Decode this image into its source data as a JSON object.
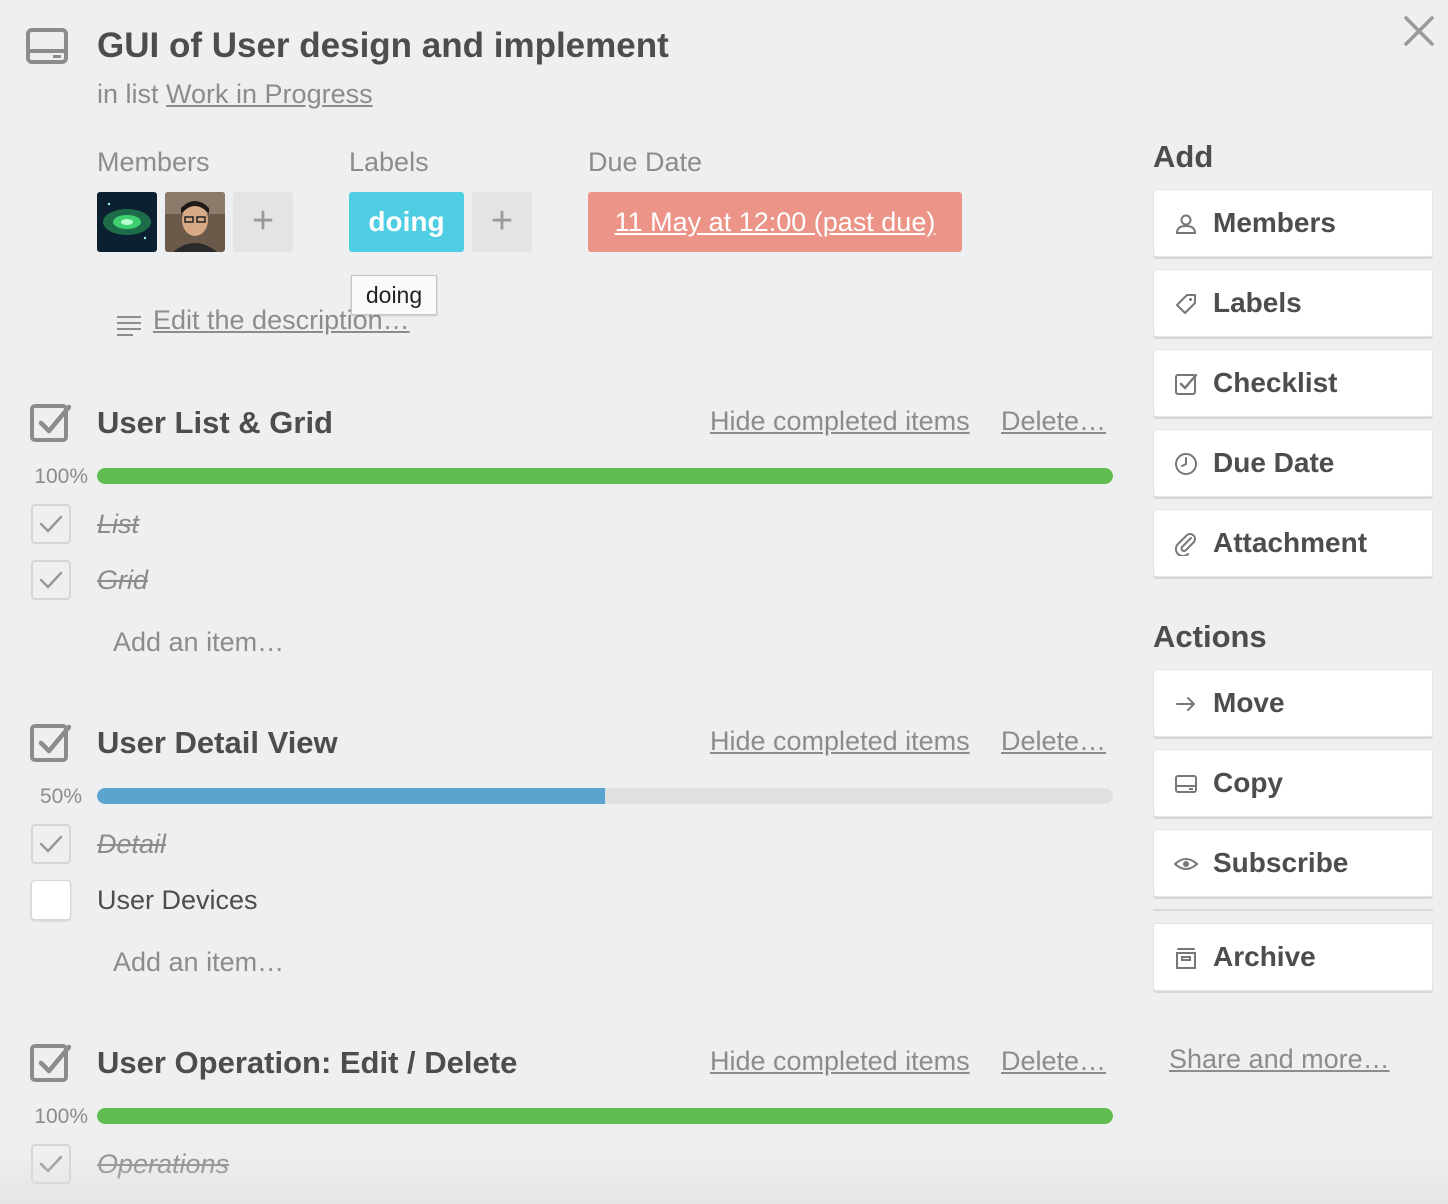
{
  "card": {
    "title": "GUI of User design and implement",
    "list_prefix": "in list",
    "list_name": "Work in Progress"
  },
  "meta": {
    "members_label": "Members",
    "labels_label": "Labels",
    "due_label": "Due Date",
    "add_symbol": "+",
    "label_chip": "doing",
    "label_color": "#4fcde3",
    "due_value": "11 May at 12:00 (past due)",
    "due_color": "#ec9488",
    "tooltip": "doing"
  },
  "description": {
    "link": "Edit the description…"
  },
  "checklists": [
    {
      "title": "User List & Grid",
      "hide_label": "Hide completed items",
      "delete_label": "Delete…",
      "percent_text": "100%",
      "progress": 1.0,
      "bar_color": "#61bd4f",
      "items": [
        {
          "text": "List",
          "checked": true
        },
        {
          "text": "Grid",
          "checked": true
        }
      ],
      "add_item": "Add an item…"
    },
    {
      "title": "User Detail View",
      "hide_label": "Hide completed items",
      "delete_label": "Delete…",
      "percent_text": "50%",
      "progress": 0.5,
      "bar_color": "#5ba4cf",
      "items": [
        {
          "text": "Detail",
          "checked": true
        },
        {
          "text": "User Devices",
          "checked": false
        }
      ],
      "add_item": "Add an item…"
    },
    {
      "title": "User Operation: Edit / Delete",
      "hide_label": "Hide completed items",
      "delete_label": "Delete…",
      "percent_text": "100%",
      "progress": 1.0,
      "bar_color": "#61bd4f",
      "items": [
        {
          "text": "Operations",
          "checked": true
        }
      ]
    }
  ],
  "sidebar": {
    "add_heading": "Add",
    "add_buttons": [
      {
        "label": "Members",
        "icon": "person-icon"
      },
      {
        "label": "Labels",
        "icon": "tag-icon"
      },
      {
        "label": "Checklist",
        "icon": "checkbox-icon"
      },
      {
        "label": "Due Date",
        "icon": "clock-icon"
      },
      {
        "label": "Attachment",
        "icon": "paperclip-icon"
      }
    ],
    "actions_heading": "Actions",
    "action_buttons": [
      {
        "label": "Move",
        "icon": "arrow-right-icon"
      },
      {
        "label": "Copy",
        "icon": "card-icon"
      },
      {
        "label": "Subscribe",
        "icon": "eye-icon"
      }
    ],
    "archive_button": {
      "label": "Archive",
      "icon": "archive-icon"
    },
    "share_link": "Share and more…"
  }
}
